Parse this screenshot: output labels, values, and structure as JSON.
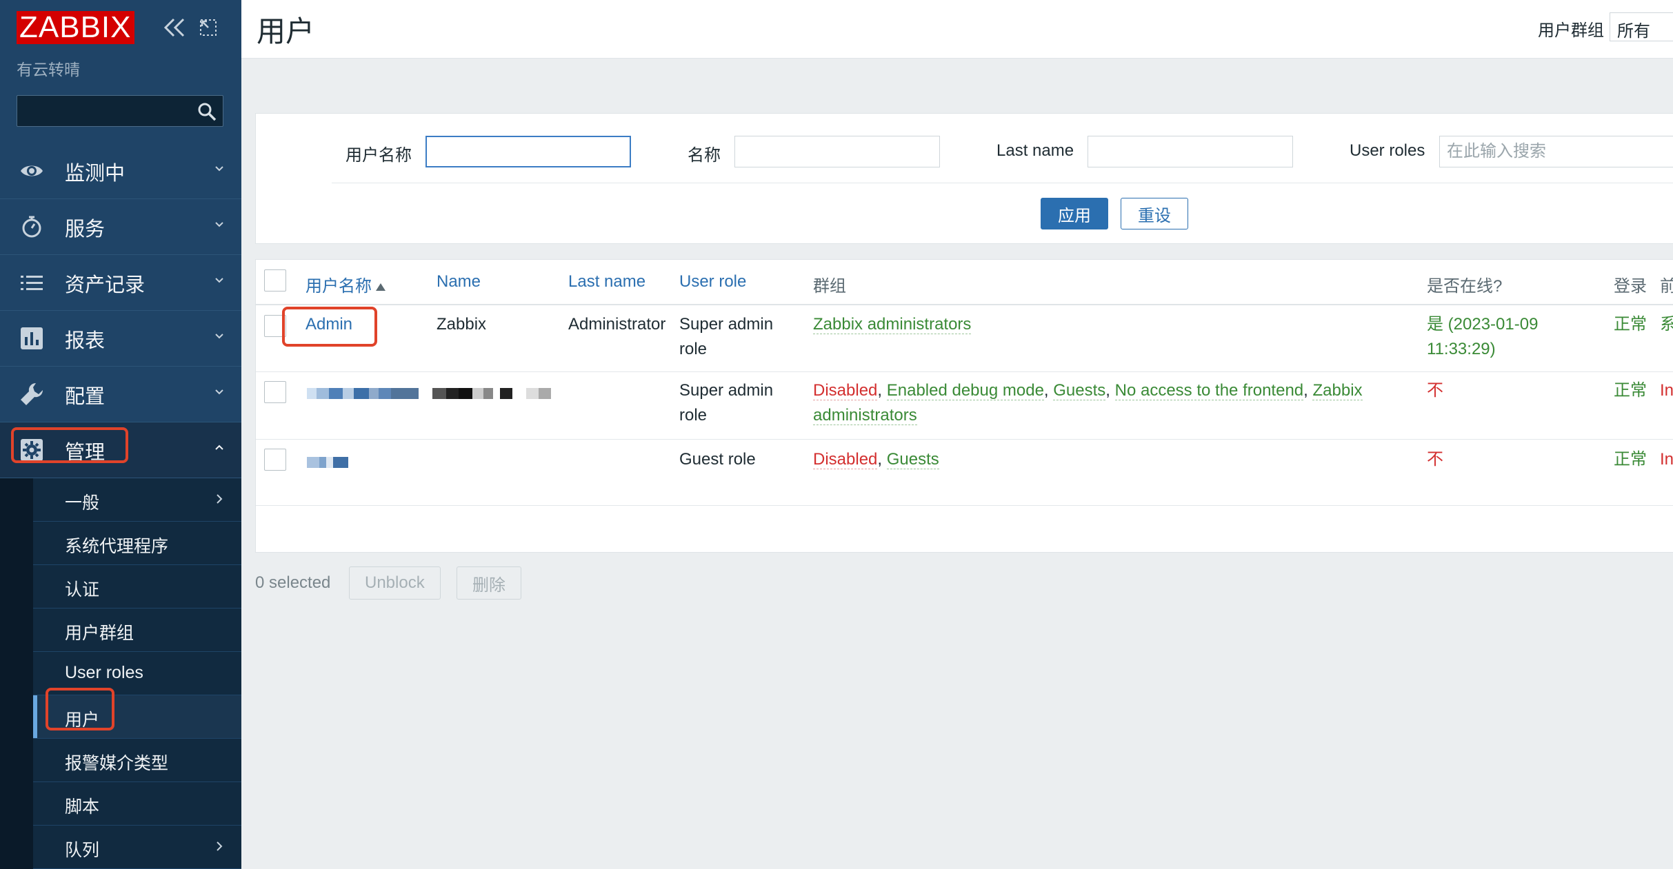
{
  "sidebar": {
    "logo": "ZABBIX",
    "tagline": "有云转晴",
    "search_placeholder": "",
    "menu": [
      {
        "label": "监测中",
        "icon": "eye-icon"
      },
      {
        "label": "服务",
        "icon": "stopwatch-icon"
      },
      {
        "label": "资产记录",
        "icon": "list-icon"
      },
      {
        "label": "报表",
        "icon": "bar-chart-icon"
      },
      {
        "label": "配置",
        "icon": "wrench-icon"
      },
      {
        "label": "管理",
        "icon": "gear-icon"
      }
    ],
    "submenu": [
      {
        "label": "一般"
      },
      {
        "label": "系统代理程序"
      },
      {
        "label": "认证"
      },
      {
        "label": "用户群组"
      },
      {
        "label": "User roles"
      },
      {
        "label": "用户"
      },
      {
        "label": "报警媒介类型"
      },
      {
        "label": "脚本"
      },
      {
        "label": "队列"
      }
    ]
  },
  "header": {
    "title": "用户",
    "group_filter_label": "用户群组",
    "group_filter_value": "所有"
  },
  "filter": {
    "username_label": "用户名称",
    "username_value": "",
    "name_label": "名称",
    "name_value": "",
    "lastname_label": "Last name",
    "lastname_value": "",
    "roles_label": "User roles",
    "roles_placeholder": "在此输入搜索",
    "apply_label": "应用",
    "reset_label": "重设"
  },
  "table": {
    "columns": {
      "username": "用户名称",
      "name": "Name",
      "lastname": "Last name",
      "role": "User role",
      "groups": "群组",
      "online": "是否在线?",
      "login": "登录",
      "frontend": "前"
    },
    "rows": [
      {
        "username": "Admin",
        "name": "Zabbix",
        "lastname": "Administrator",
        "role_line1": "Super admin",
        "role_line2": "role",
        "groups": [
          "Zabbix administrators"
        ],
        "online_line1": "是 (2023-01-09",
        "online_line2": "11:33:29)",
        "login": "正常",
        "frontend": "系"
      },
      {
        "role_line1": "Super admin",
        "role_line2": "role",
        "groups_line1": [
          "Disabled",
          "Enabled debug mode",
          "Guests",
          "No access to the frontend",
          "Zabbix"
        ],
        "groups_line2": "administrators",
        "online": "不",
        "login": "正常",
        "frontend": "In"
      },
      {
        "role": "Guest role",
        "groups": [
          "Disabled",
          "Guests"
        ],
        "online": "不",
        "login": "正常",
        "frontend": "In"
      }
    ]
  },
  "footer": {
    "selected": "0 selected",
    "unblock_label": "Unblock",
    "delete_label": "删除"
  },
  "colors": {
    "sidebar_bg": "#1f4467",
    "accent_blue": "#2b6fb0",
    "status_green": "#3a8a36",
    "status_red": "#d32f2f",
    "logo_red": "#d40000",
    "highlight": "#e0432a"
  }
}
